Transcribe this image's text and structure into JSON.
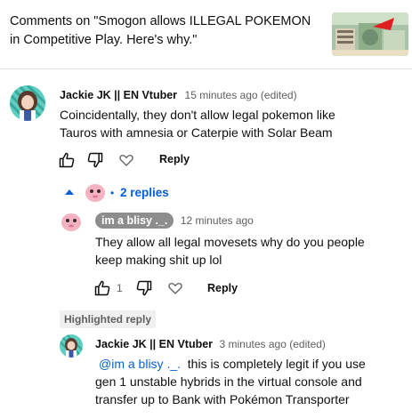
{
  "header": {
    "title": "Comments on \"Smogon allows ILLEGAL POKEMON in Competitive Play. Here's why.\"",
    "thumbnail_icon": "video-thumbnail"
  },
  "comment": {
    "author": "Jackie JK || EN Vtuber",
    "time": "15 minutes ago (edited)",
    "text": "Coincidentally, they don't allow legal pokemon like Tauros with amnesia or Caterpie with Solar Beam",
    "like_icon": "thumbs-up-icon",
    "dislike_icon": "thumbs-down-icon",
    "heart_icon": "heart-icon",
    "reply_label": "Reply"
  },
  "replies_toggle": {
    "label": "2 replies",
    "separator": "•"
  },
  "reply1": {
    "author": "im a blisy ._.",
    "time": "12 minutes ago",
    "text": "They allow all legal movesets why do you people keep making shit up lol",
    "like_count": "1",
    "reply_label": "Reply"
  },
  "highlighted": {
    "chip_label": "Highlighted reply",
    "author": "Jackie JK || EN Vtuber",
    "time": "3 minutes ago (edited)",
    "mention": "@im a blisy ._.",
    "text": "this is completely legit if you use gen 1 unstable hybrids in the virtual console and transfer up to Bank with Pokémon Transporter"
  },
  "colors": {
    "link_blue": "#065fd4",
    "meta_gray": "#606060",
    "chip_gray": "#8d8d8d"
  }
}
